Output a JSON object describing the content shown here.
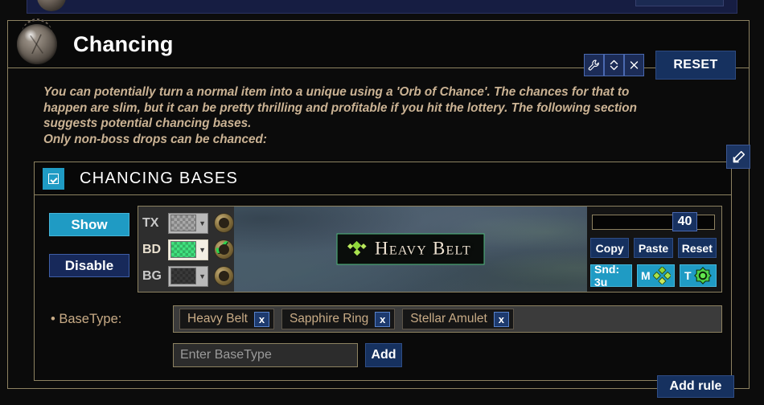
{
  "top_panel": {
    "partial": true
  },
  "header": {
    "title": "Chancing",
    "icon": "orb-of-chance-icon",
    "tools": [
      {
        "name": "wrench-icon",
        "glyph": "⚒"
      },
      {
        "name": "collapse-expand-icon",
        "glyph": "⇅"
      },
      {
        "name": "close-icon",
        "glyph": "✖"
      }
    ],
    "reset_label": "RESET"
  },
  "description": {
    "line1": "You can potentially turn a normal item into a unique using a 'Orb of Chance'. The chances for that to",
    "line2": "happen are slim, but it can be pretty thrilling and profitable if you hit the lottery. The following section",
    "line3": "suggests potential chancing bases.",
    "line4": "Only non-boss drops can be chanced:"
  },
  "section": {
    "title": "CHANCING BASES",
    "checkbox_checked": true,
    "edit_label": "edit"
  },
  "side_buttons": {
    "show_label": "Show",
    "disable_label": "Disable"
  },
  "style_editor": {
    "rows": [
      {
        "label": "TX",
        "color": "#a9a9a9",
        "selected": false,
        "checked": false
      },
      {
        "label": "BD",
        "color": "#41e37f",
        "selected": true,
        "checked": true
      },
      {
        "label": "BG",
        "color": "#3a3a3a",
        "selected": false,
        "checked": false
      }
    ]
  },
  "preview": {
    "item_name": "Heavy Belt",
    "icon": "green-diamond-cluster-icon",
    "border_color": "#4fba7c",
    "text_color": "#efe3d2"
  },
  "right_controls": {
    "slider_value": "40",
    "buttons": [
      "Copy",
      "Paste",
      "Reset"
    ],
    "sound_label": "Snd: 3u",
    "minimap_label": "M",
    "beam_label": "T"
  },
  "basetype": {
    "label": "• BaseType:",
    "chips": [
      "Heavy Belt",
      "Sapphire Ring",
      "Stellar Amulet"
    ],
    "remove_label": "x",
    "input_value": "",
    "input_placeholder": "Enter BaseType",
    "add_label": "Add"
  },
  "footer": {
    "add_rule_label": "Add rule"
  },
  "colors": {
    "accent_cyan": "#1f9bc4",
    "accent_navy": "#16315f",
    "border_tan": "#8d8261",
    "text_tan": "#c8ab86",
    "green": "#41e37f"
  }
}
